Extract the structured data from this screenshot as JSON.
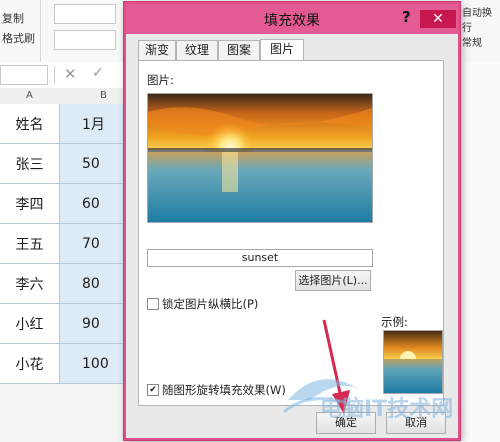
{
  "ribbon": {
    "copy_label": "复制",
    "painter_label": "格式刷",
    "wrap_label": "自动换行",
    "general_label": "常规"
  },
  "columns": [
    "A",
    "B"
  ],
  "sheet": {
    "rows": [
      {
        "name": "姓名",
        "val": "1月"
      },
      {
        "name": "张三",
        "val": "50"
      },
      {
        "name": "李四",
        "val": "60"
      },
      {
        "name": "王五",
        "val": "70"
      },
      {
        "name": "李六",
        "val": "80"
      },
      {
        "name": "小红",
        "val": "90"
      },
      {
        "name": "小花",
        "val": "100"
      }
    ]
  },
  "dialog": {
    "title": "填充效果",
    "help": "?",
    "close": "✕",
    "tabs": [
      "渐变",
      "纹理",
      "图案",
      "图片"
    ],
    "active_tab": "图片",
    "picture_label": "图片:",
    "picture_name": "sunset",
    "select_button": "选择图片(L)...",
    "lock_aspect_label": "锁定图片纵横比(P)",
    "lock_aspect_checked": false,
    "rotate_label": "随图形旋转填充效果(W)",
    "rotate_checked": true,
    "sample_label": "示例:",
    "ok_button": "确定",
    "cancel_button": "取消"
  },
  "watermark": {
    "text": "电脑IT技术网"
  },
  "colors": {
    "title_bar": "#e45a92",
    "close_button": "#c7174f",
    "cell_fill": "#dcebf6",
    "arrow": "#d6294f"
  },
  "icons": {
    "help": "help-icon",
    "close": "close-icon",
    "cancel_fx": "cancel-icon",
    "enter_fx": "checkmark-icon"
  }
}
